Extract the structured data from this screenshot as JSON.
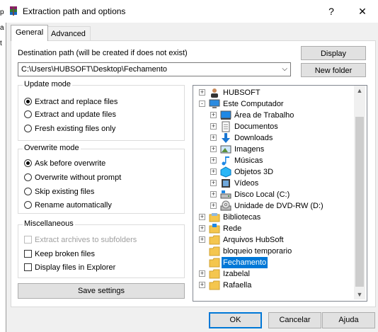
{
  "window": {
    "title": "Extraction path and options",
    "help_glyph": "?",
    "close_glyph": "✕",
    "bg_chars": [
      "p",
      "a",
      "t"
    ]
  },
  "tabs": [
    {
      "label": "General",
      "active": true
    },
    {
      "label": "Advanced",
      "active": false
    }
  ],
  "destination": {
    "label": "Destination path (will be created if does not exist)",
    "value": "C:\\Users\\HUBSOFT\\Desktop\\Fechamento",
    "display_button": "Display",
    "new_folder_button": "New folder"
  },
  "update_mode": {
    "title": "Update mode",
    "options": [
      {
        "label": "Extract and replace files",
        "selected": true
      },
      {
        "label": "Extract and update files",
        "selected": false
      },
      {
        "label": "Fresh existing files only",
        "selected": false
      }
    ]
  },
  "overwrite_mode": {
    "title": "Overwrite mode",
    "options": [
      {
        "label": "Ask before overwrite",
        "selected": true
      },
      {
        "label": "Overwrite without prompt",
        "selected": false
      },
      {
        "label": "Skip existing files",
        "selected": false
      },
      {
        "label": "Rename automatically",
        "selected": false
      }
    ]
  },
  "miscellaneous": {
    "title": "Miscellaneous",
    "options": [
      {
        "label": "Extract archives to subfolders",
        "checked": false,
        "disabled": true
      },
      {
        "label": "Keep broken files",
        "checked": false,
        "disabled": false
      },
      {
        "label": "Display files in Explorer",
        "checked": false,
        "disabled": false
      }
    ]
  },
  "save_settings_button": "Save settings",
  "tree": {
    "nodes": [
      {
        "label": "HUBSOFT",
        "icon": "user-icon",
        "level": 1,
        "expander": "+"
      },
      {
        "label": "Este Computador",
        "icon": "computer-icon",
        "level": 1,
        "expander": "-"
      },
      {
        "label": "Área de Trabalho",
        "icon": "desktop-icon",
        "level": 2,
        "expander": "+"
      },
      {
        "label": "Documentos",
        "icon": "documents-icon",
        "level": 2,
        "expander": "+"
      },
      {
        "label": "Downloads",
        "icon": "downloads-icon",
        "level": 2,
        "expander": "+"
      },
      {
        "label": "Imagens",
        "icon": "pictures-icon",
        "level": 2,
        "expander": "+"
      },
      {
        "label": "Músicas",
        "icon": "music-icon",
        "level": 2,
        "expander": "+"
      },
      {
        "label": "Objetos 3D",
        "icon": "objects-3d-icon",
        "level": 2,
        "expander": "+"
      },
      {
        "label": "Vídeos",
        "icon": "videos-icon",
        "level": 2,
        "expander": "+"
      },
      {
        "label": "Disco Local (C:)",
        "icon": "drive-icon",
        "level": 2,
        "expander": "+"
      },
      {
        "label": "Unidade de DVD-RW (D:)",
        "icon": "dvd-drive-icon",
        "level": 2,
        "expander": "+"
      },
      {
        "label": "Bibliotecas",
        "icon": "libraries-icon",
        "level": 1,
        "expander": "+"
      },
      {
        "label": "Rede",
        "icon": "network-icon",
        "level": 1,
        "expander": "+"
      },
      {
        "label": "Arquivos HubSoft",
        "icon": "folder-icon",
        "level": 1,
        "expander": "+"
      },
      {
        "label": "bloqueio temporario",
        "icon": "folder-icon",
        "level": 1,
        "expander": ""
      },
      {
        "label": "Fechamento",
        "icon": "folder-icon",
        "level": 1,
        "expander": "",
        "selected": true
      },
      {
        "label": "Izabelal",
        "icon": "folder-icon",
        "level": 1,
        "expander": "+"
      },
      {
        "label": "Rafaella",
        "icon": "folder-icon",
        "level": 1,
        "expander": "+"
      }
    ]
  },
  "footer": {
    "ok": "OK",
    "cancel": "Cancelar",
    "help": "Ajuda"
  },
  "colors": {
    "selection": "#0078d7",
    "folder": "#f4c64e",
    "default_button_border": "#0078d7"
  }
}
